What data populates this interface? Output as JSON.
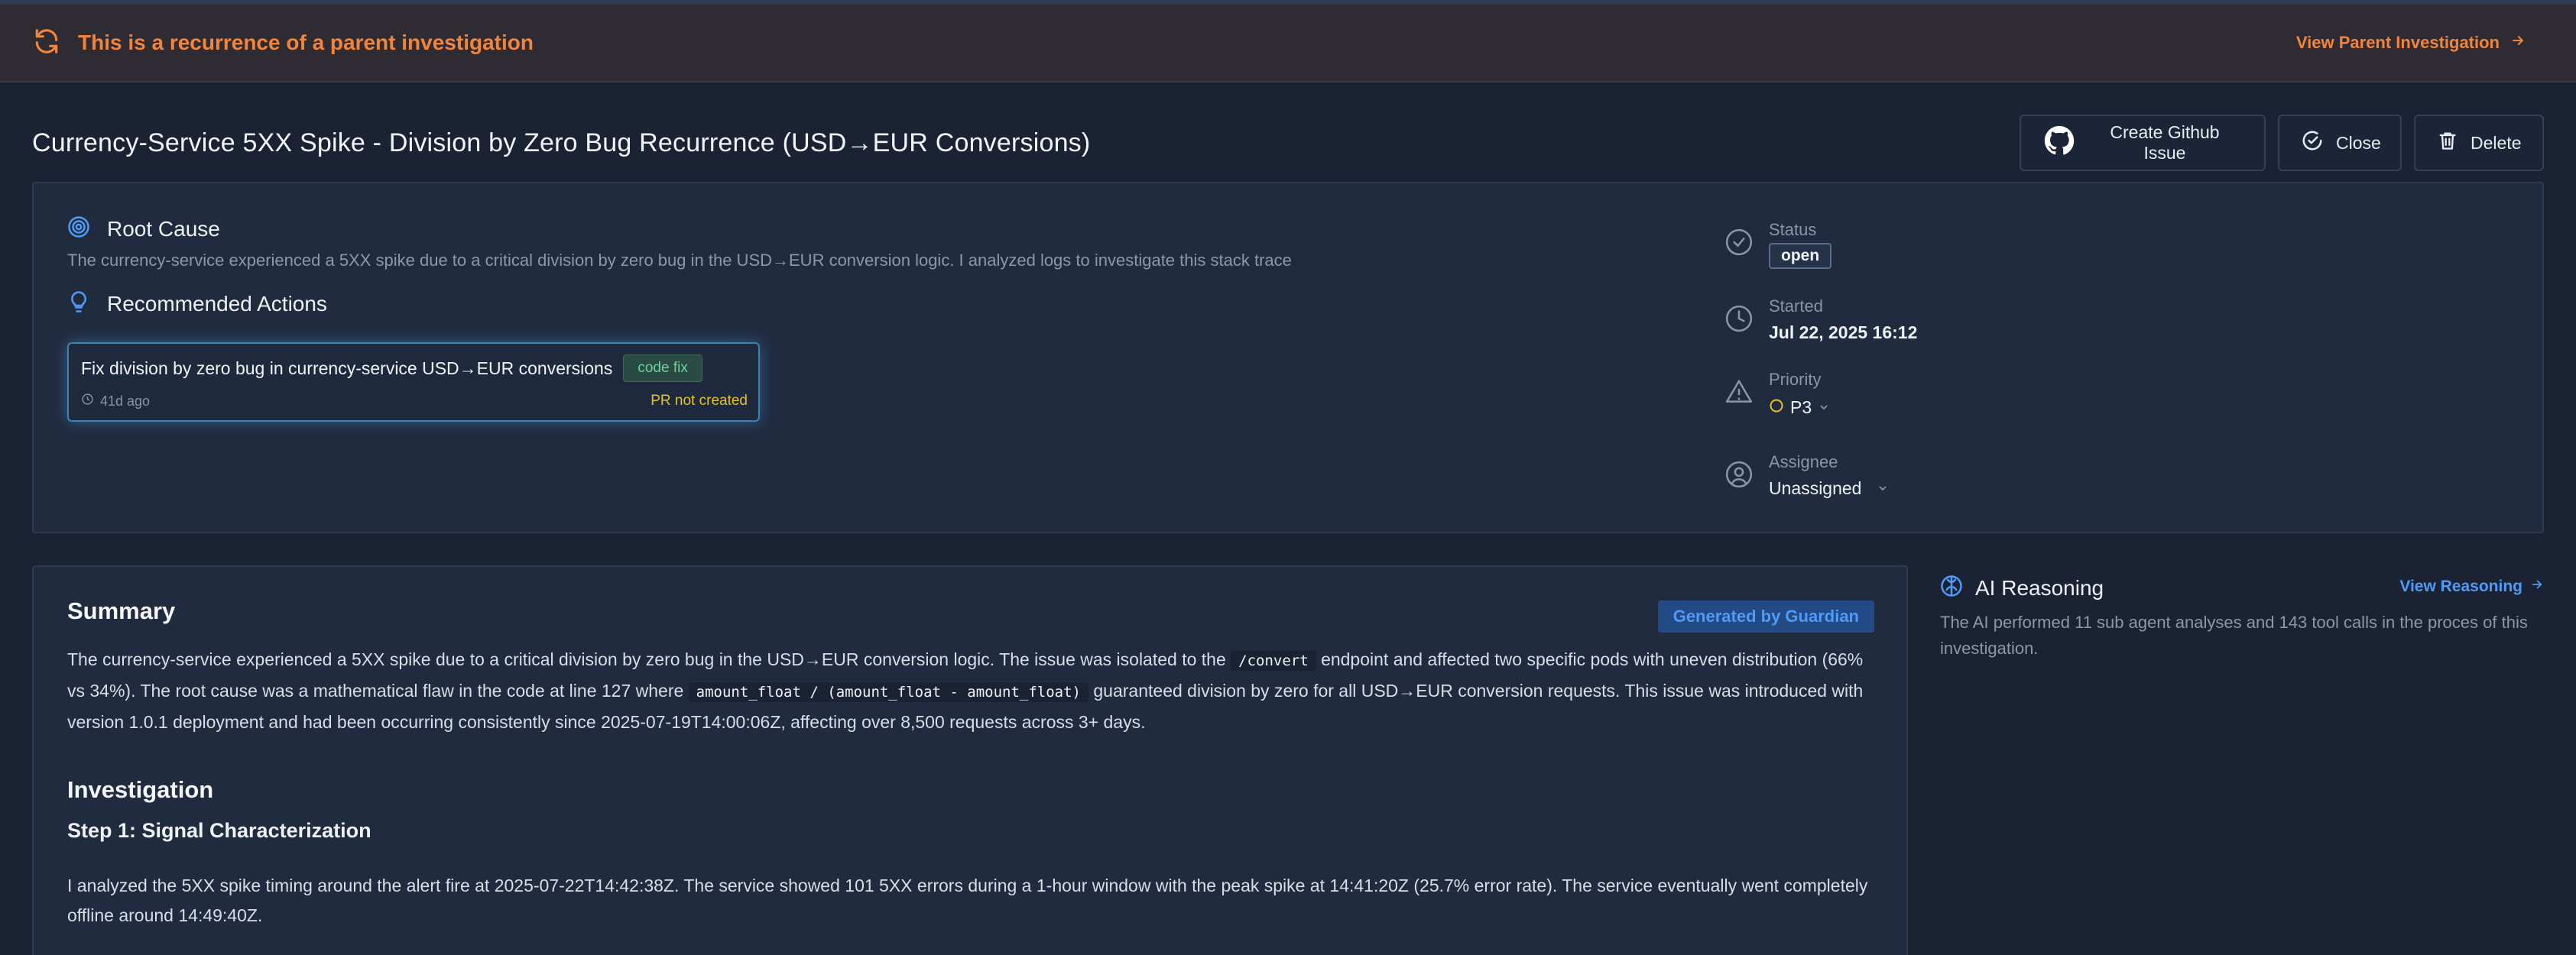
{
  "banner": {
    "text": "This is a recurrence of a parent investigation",
    "link": "View Parent Investigation"
  },
  "header": {
    "title": "Currency-Service 5XX Spike - Division by Zero Bug Recurrence (USD→EUR Conversions)",
    "github_btn": "Create Github Issue",
    "close_btn": "Close",
    "delete_btn": "Delete"
  },
  "root_cause": {
    "title": "Root Cause",
    "description": "The currency-service experienced a 5XX spike due to a critical division by zero bug in the USD→EUR conversion logic. I analyzed logs to investigate this stack trace"
  },
  "recommended": {
    "title": "Recommended Actions",
    "card": {
      "title": "Fix division by zero bug in currency-service USD→EUR conversions",
      "tag": "code fix",
      "time": "41d ago",
      "pr_status": "PR not created"
    }
  },
  "meta": {
    "status_label": "Status",
    "status_value": "open",
    "started_label": "Started",
    "started_value": "Jul 22, 2025 16:12",
    "priority_label": "Priority",
    "priority_value": "P3",
    "assignee_label": "Assignee",
    "assignee_value": "Unassigned"
  },
  "summary": {
    "title": "Summary",
    "badge": "Generated by Guardian",
    "p1_a": "The currency-service experienced a 5XX spike due to a critical division by zero bug in the USD→EUR conversion logic. The issue was isolated to the",
    "p1_code1": "/convert",
    "p1_b": "endpoint and affected two specific pods with uneven distribution (66% vs 34%). The root cause was a mathematical flaw in the code at line 127 where",
    "p1_code2": "amount_float / (amount_float - amount_float)",
    "p1_c": "guaranteed division by zero for all USD→EUR conversion requests. This issue was introduced with version 1.0.1 deployment and had been occurring consistently since 2025-07-19T14:00:06Z, affecting over 8,500 requests across 3+ days."
  },
  "investigation": {
    "title": "Investigation",
    "step1_title": "Step 1: Signal Characterization",
    "step1_text": "I analyzed the 5XX spike timing around the alert fire at 2025-07-22T14:42:38Z. The service showed 101 5XX errors during a 1-hour window with the peak spike at 14:41:20Z (25.7% error rate). The service eventually went completely offline around 14:49:40Z."
  },
  "ai_reasoning": {
    "title": "AI Reasoning",
    "link": "View Reasoning",
    "text": "The AI performed 11 sub agent analyses and 143 tool calls in the proces of this investigation."
  },
  "colors": {
    "background": "#1a2233",
    "panel": "#212b40",
    "banner_accent": "#f1853e",
    "link_blue": "#4f9bf5",
    "code_fix_green": "#6fd39c",
    "pr_yellow": "#e6c229"
  },
  "icons": {
    "banner": "recurrence-icon",
    "root_cause": "target-icon",
    "recommended": "lightbulb-icon",
    "status": "check-circle-icon",
    "started": "clock-icon",
    "priority": "warning-triangle-icon",
    "assignee": "user-circle-icon",
    "ai": "brain-icon"
  }
}
